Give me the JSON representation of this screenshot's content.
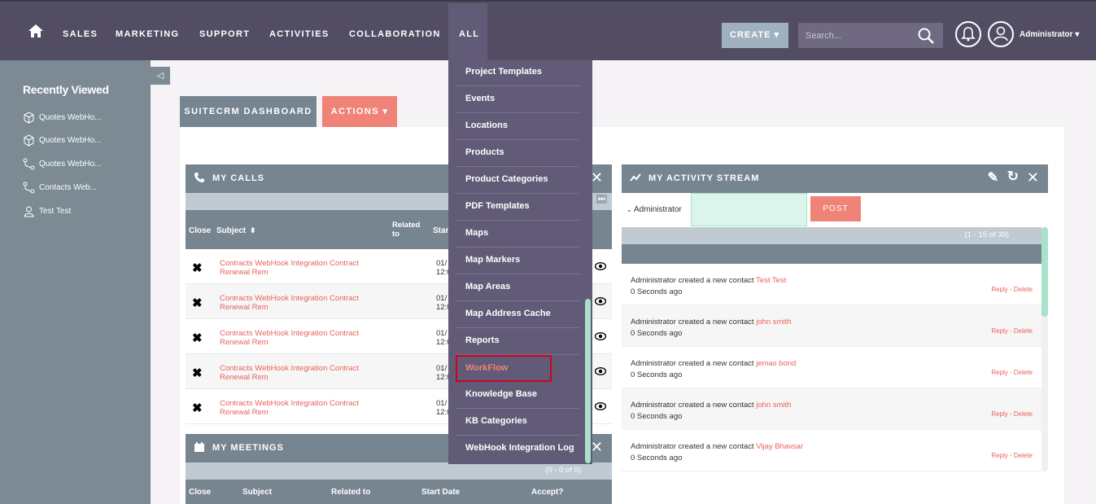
{
  "nav": {
    "items": [
      "SALES",
      "MARKETING",
      "SUPPORT",
      "ACTIVITIES",
      "COLLABORATION",
      "ALL"
    ],
    "create_label": "CREATE ▾",
    "search_placeholder": "Search...",
    "user_label": "Administrator ▾"
  },
  "sidebar": {
    "title": "Recently Viewed",
    "items": [
      "Quotes WebHo...",
      "Quotes WebHo...",
      "Quotes WebHo...",
      "Contacts Web...",
      "Test Test"
    ]
  },
  "dashboard": {
    "tab_label": "SUITECRM DASHBOARD",
    "actions_label": "ACTIONS ▾"
  },
  "calls": {
    "title": "MY CALLS",
    "col_close": "Close",
    "col_subject": "Subject",
    "col_related": "Related to",
    "col_start": "Start",
    "rows": [
      {
        "subject": "Contracts WebHook Integration Contract Renewal Rem",
        "date": "01/",
        "time": "12:0"
      },
      {
        "subject": "Contracts WebHook Integration Contract Renewal Rem",
        "date": "01/",
        "time": "12:0"
      },
      {
        "subject": "Contracts WebHook Integration Contract Renewal Rem",
        "date": "01/",
        "time": "12:0"
      },
      {
        "subject": "Contracts WebHook Integration Contract Renewal Rem",
        "date": "01/",
        "time": "12:0"
      },
      {
        "subject": "Contracts WebHook Integration Contract Renewal Rem",
        "date": "01/",
        "time": "12:0"
      }
    ]
  },
  "meetings": {
    "title": "MY MEETINGS",
    "paging": "(0 - 0 of 0)",
    "cols": [
      "Close",
      "Subject",
      "Related to",
      "Start Date",
      "Accept?"
    ]
  },
  "activity": {
    "title": "MY ACTIVITY STREAM",
    "user": "Administrator",
    "post_label": "POST",
    "paging": "(1 - 15 of 39)",
    "posts": [
      {
        "who": "Administrator",
        "action": "created a new contact",
        "target": "Test Test",
        "ago": "0 Seconds ago",
        "reply": "Reply",
        "delete": "Delete"
      },
      {
        "who": "Administrator",
        "action": "created a new contact",
        "target": "john smith",
        "ago": "0 Seconds ago",
        "reply": "Reply",
        "delete": "Delete"
      },
      {
        "who": "Administrator",
        "action": "created a new contact",
        "target": "jemas bond",
        "ago": "0 Seconds ago",
        "reply": "Reply",
        "delete": "Delete"
      },
      {
        "who": "Administrator",
        "action": "created a new contact",
        "target": "john smith",
        "ago": "0 Seconds ago",
        "reply": "Reply",
        "delete": "Delete"
      },
      {
        "who": "Administrator",
        "action": "created a new contact",
        "target": "Vijay Bhavsar",
        "ago": "0 Seconds ago",
        "reply": "Reply",
        "delete": "Delete"
      }
    ]
  },
  "all_menu": {
    "items": [
      "Project Templates",
      "Events",
      "Locations",
      "Products",
      "Product Categories",
      "PDF Templates",
      "Maps",
      "Map Markers",
      "Map Areas",
      "Map Address Cache",
      "Reports",
      "WorkFlow",
      "Knowledge Base",
      "KB Categories",
      "WebHook Integration Log"
    ],
    "highlighted": "WorkFlow"
  }
}
